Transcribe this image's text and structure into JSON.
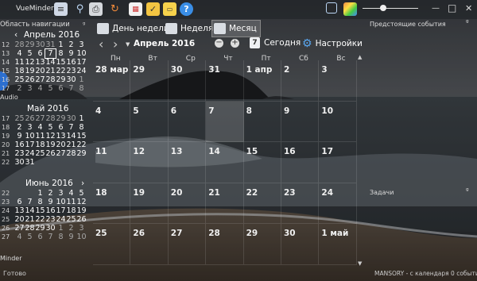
{
  "app": {
    "title": "VueMinder"
  },
  "window_controls": {
    "minimize": "—",
    "maximize": "□",
    "close": "✕"
  },
  "left_panel": {
    "header": "Область навигации",
    "side_label_1": "Audio",
    "side_label_2": "Minder",
    "status": "Готово",
    "months": [
      {
        "title": "Апрель 2016",
        "weeks": [
          "12",
          "13",
          "14",
          "15",
          "16",
          "17"
        ],
        "rows": [
          [
            "28",
            "29",
            "30",
            "31",
            "1",
            "2",
            "3"
          ],
          [
            "4",
            "5",
            "6",
            "7",
            "8",
            "9",
            "10"
          ],
          [
            "11",
            "12",
            "13",
            "14",
            "15",
            "16",
            "17"
          ],
          [
            "18",
            "19",
            "20",
            "21",
            "22",
            "23",
            "24"
          ],
          [
            "25",
            "26",
            "27",
            "28",
            "29",
            "30",
            "1"
          ],
          [
            "2",
            "3",
            "4",
            "5",
            "6",
            "7",
            "8"
          ]
        ]
      },
      {
        "title": "Май 2016",
        "weeks": [
          "17",
          "18",
          "19",
          "20",
          "21",
          "22"
        ],
        "rows": [
          [
            "25",
            "26",
            "27",
            "28",
            "29",
            "30",
            "1"
          ],
          [
            "2",
            "3",
            "4",
            "5",
            "6",
            "7",
            "8"
          ],
          [
            "9",
            "10",
            "11",
            "12",
            "13",
            "14",
            "15"
          ],
          [
            "16",
            "17",
            "18",
            "19",
            "20",
            "21",
            "22"
          ],
          [
            "23",
            "24",
            "25",
            "26",
            "27",
            "28",
            "29"
          ],
          [
            "30",
            "31",
            "",
            "",
            "",
            "",
            ""
          ]
        ]
      },
      {
        "title": "Июнь 2016",
        "weeks": [
          "22",
          "23",
          "24",
          "25",
          "26",
          "27"
        ],
        "rows": [
          [
            "",
            "",
            "1",
            "2",
            "3",
            "4",
            "5"
          ],
          [
            "6",
            "7",
            "8",
            "9",
            "10",
            "11",
            "12"
          ],
          [
            "13",
            "14",
            "15",
            "16",
            "17",
            "18",
            "19"
          ],
          [
            "20",
            "21",
            "22",
            "23",
            "24",
            "25",
            "26"
          ],
          [
            "27",
            "28",
            "29",
            "30",
            "1",
            "2",
            "3"
          ],
          [
            "4",
            "5",
            "6",
            "7",
            "8",
            "9",
            "10"
          ]
        ]
      }
    ]
  },
  "view_tabs": {
    "week_day": "День недели",
    "week": "Неделя",
    "month": "Месяц"
  },
  "nav": {
    "prev": "‹",
    "next": "›",
    "period": "Апрель 2016",
    "today": "Сегодня",
    "settings": "Настройки",
    "today_num": "7"
  },
  "month_view": {
    "weekdays": [
      "Пн",
      "Вт",
      "Ср",
      "Чт",
      "Пт",
      "Сб",
      "Вс"
    ],
    "rows": [
      [
        "28 мар",
        "29",
        "30",
        "31",
        "1 апр",
        "2",
        "3"
      ],
      [
        "4",
        "5",
        "6",
        "7",
        "8",
        "9",
        "10"
      ],
      [
        "11",
        "12",
        "13",
        "14",
        "15",
        "16",
        "17"
      ],
      [
        "18",
        "19",
        "20",
        "21",
        "22",
        "23",
        "24"
      ],
      [
        "25",
        "26",
        "27",
        "28",
        "29",
        "30",
        "1 май"
      ]
    ]
  },
  "right_panel": {
    "upcoming": "Предстоящие события",
    "tasks": "Задачи",
    "pin": "ᵍ",
    "status": "MANSORY - с календаря 0 событий"
  },
  "colors": {
    "accent": "#3a8ee6",
    "today_highlight": "#ffffff"
  }
}
